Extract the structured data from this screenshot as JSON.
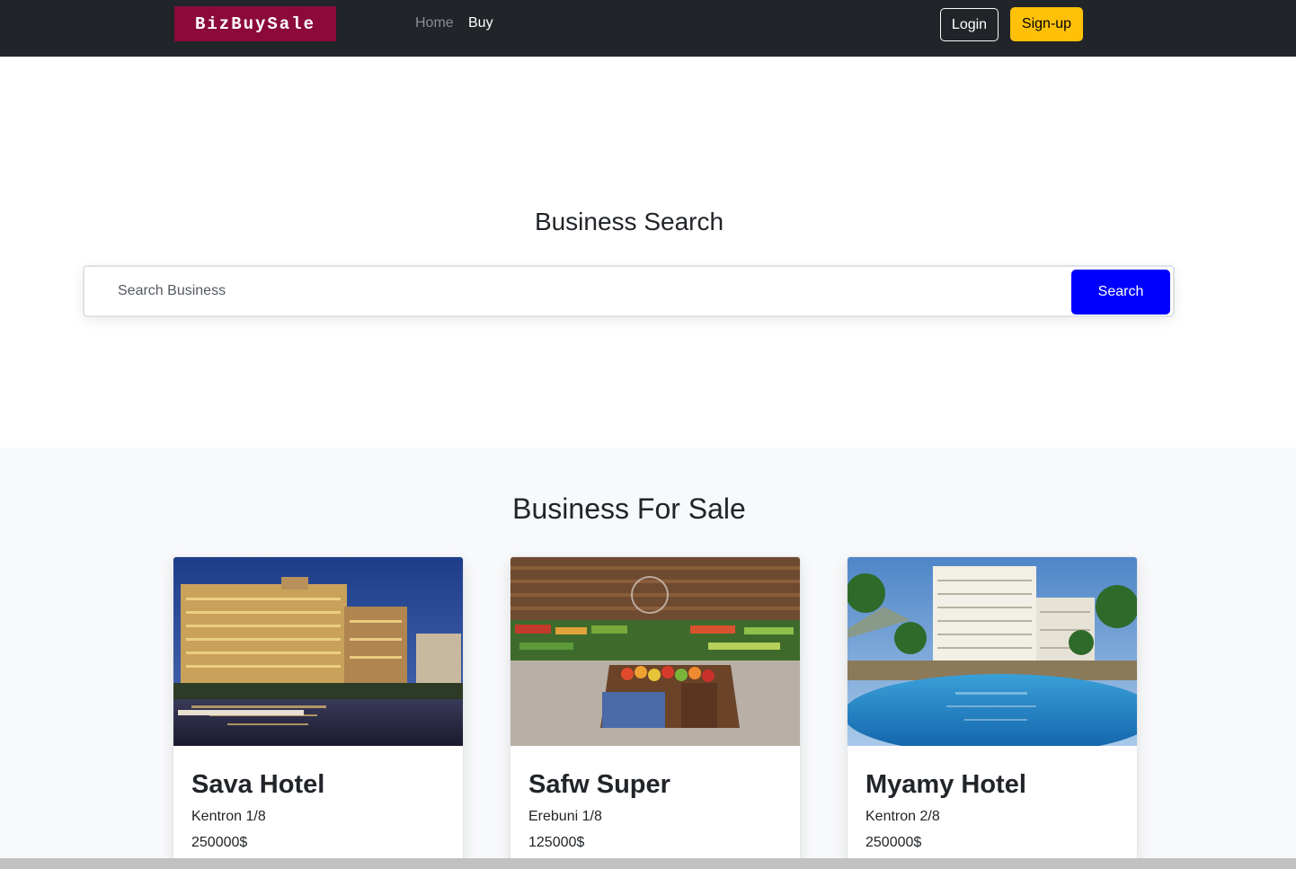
{
  "navbar": {
    "brand": "BizBuySale",
    "links": [
      {
        "label": "Home",
        "active": false
      },
      {
        "label": "Buy",
        "active": true
      }
    ],
    "login_label": "Login",
    "signup_label": "Sign-up"
  },
  "hero": {
    "title": "Business Search",
    "search_placeholder": "Search Business",
    "search_button": "Search"
  },
  "listings": {
    "title": "Business For Sale",
    "cards": [
      {
        "name": "Sava Hotel",
        "location": "Kentron 1/8",
        "price": "250000$",
        "image": "hotel-night-icon"
      },
      {
        "name": "Safw Super",
        "location": "Erebuni 1/8",
        "price": "125000$",
        "image": "supermarket-icon"
      },
      {
        "name": "Myamy Hotel",
        "location": "Kentron 2/8",
        "price": "250000$",
        "image": "resort-pool-icon"
      }
    ]
  },
  "colors": {
    "navbar_bg": "#212529",
    "brand_bg": "#8b0a3a",
    "signup_bg": "#ffc107",
    "search_button_bg": "#0000ff",
    "listings_bg": "#f8f9fa"
  }
}
